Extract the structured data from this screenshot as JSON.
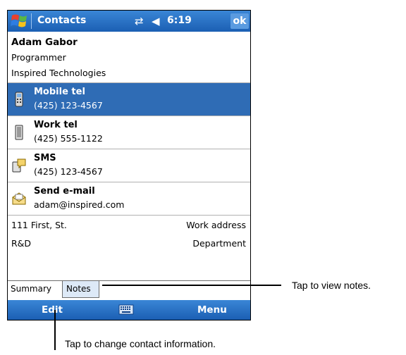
{
  "titlebar": {
    "app_title": "Contacts",
    "time": "6:19",
    "ok_label": "ok",
    "icons": [
      "windows-logo-icon",
      "connectivity-icon",
      "volume-icon"
    ]
  },
  "contact": {
    "name": "Adam Gabor",
    "job_title": "Programmer",
    "company": "Inspired Technologies"
  },
  "actions": [
    {
      "label": "Mobile tel",
      "value": "(425) 123-4567",
      "icon": "mobile-phone-icon",
      "selected": true
    },
    {
      "label": "Work tel",
      "value": "(425) 555-1122",
      "icon": "work-phone-icon",
      "selected": false
    },
    {
      "label": "SMS",
      "value": "(425) 123-4567",
      "icon": "sms-icon",
      "selected": false
    },
    {
      "label": "Send e-mail",
      "value": "adam@inspired.com",
      "icon": "email-icon",
      "selected": false
    }
  ],
  "details": [
    {
      "value": "111 First, St.",
      "label": "Work address"
    },
    {
      "value": "R&D",
      "label": "Department"
    }
  ],
  "tabs": {
    "summary": "Summary",
    "notes": "Notes"
  },
  "menubar": {
    "edit": "Edit",
    "menu": "Menu",
    "keyboard_icon": "keyboard-icon"
  },
  "callouts": {
    "notes": "Tap to view notes.",
    "edit": "Tap to change contact information."
  },
  "colors": {
    "titlebar_blue": "#1b5fb3",
    "selection_blue": "#2f6cb5",
    "notes_tab_bg": "#dde9f7"
  }
}
